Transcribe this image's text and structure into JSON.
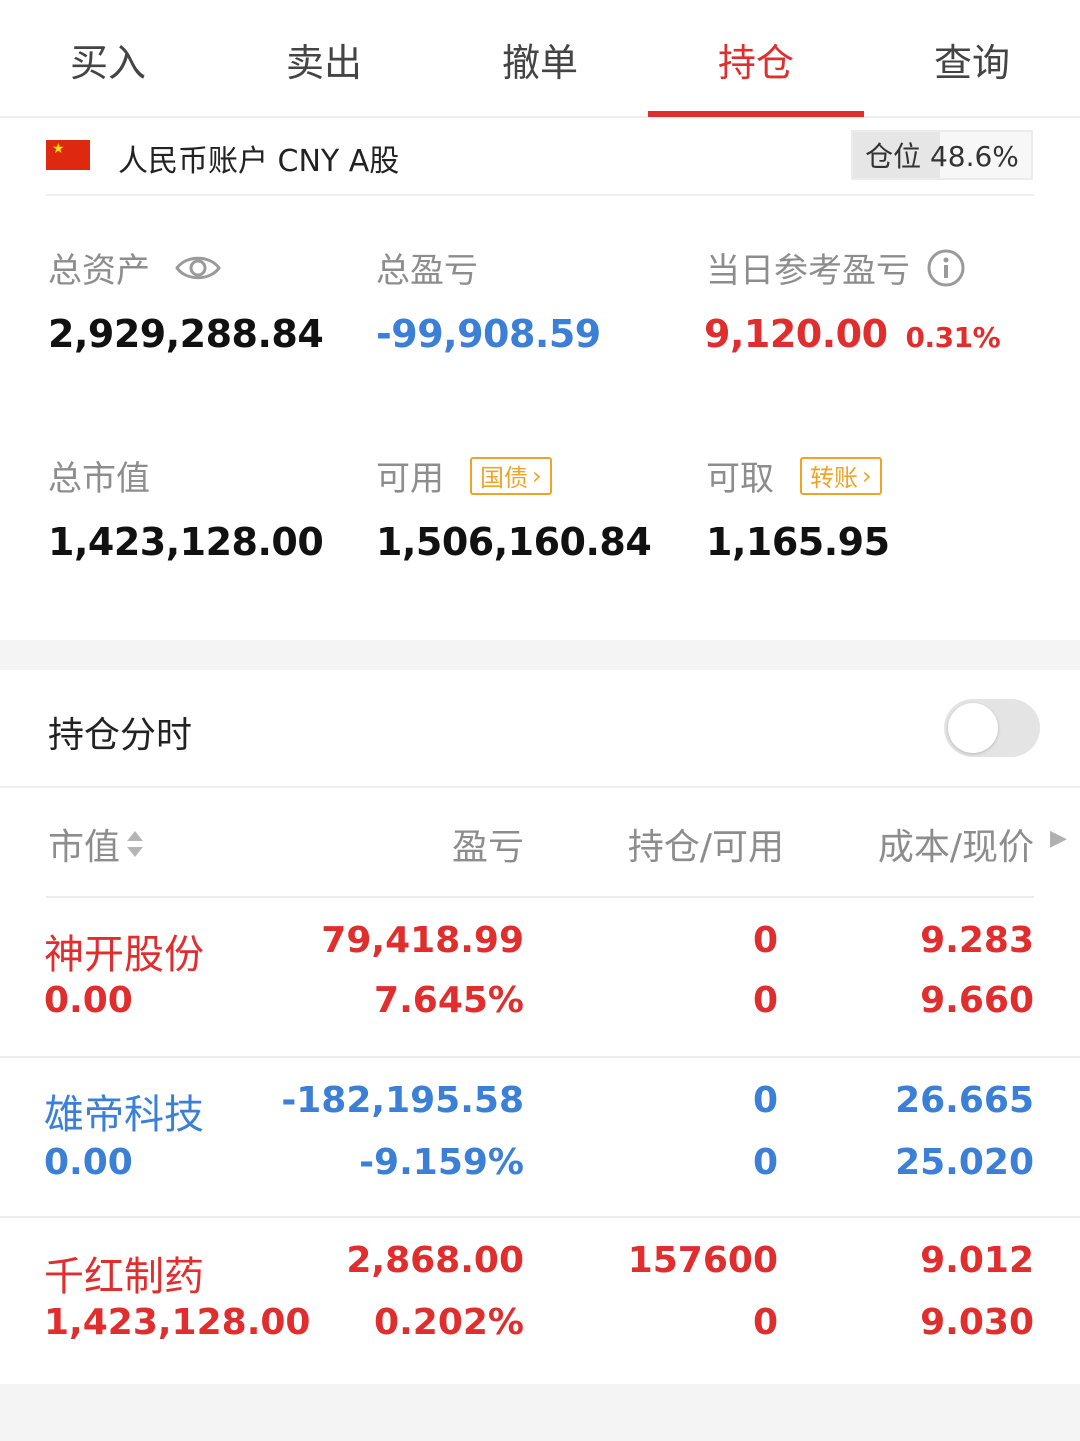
{
  "tabs": [
    {
      "label": "买入"
    },
    {
      "label": "卖出"
    },
    {
      "label": "撤单"
    },
    {
      "label": "持仓",
      "active": true
    },
    {
      "label": "查询"
    }
  ],
  "account": {
    "label": "人民币账户 CNY A股",
    "position_label": "仓位 48.6%",
    "position_fraction": 0.486,
    "flag_icon": "china-flag-icon"
  },
  "stats": {
    "total_assets": {
      "label": "总资产",
      "value": "2,929,288.84"
    },
    "total_pnl": {
      "label": "总盈亏",
      "value": "-99,908.59"
    },
    "daily_pnl": {
      "label": "当日参考盈亏",
      "value": "9,120.00",
      "pct": "0.31%"
    },
    "market_value": {
      "label": "总市值",
      "value": "1,423,128.00"
    },
    "available": {
      "label": "可用",
      "value": "1,506,160.84",
      "tag": "国债"
    },
    "withdrawable": {
      "label": "可取",
      "value": "1,165.95",
      "tag": "转账"
    }
  },
  "timeline": {
    "label": "持仓分时",
    "enabled": false
  },
  "table": {
    "headers": [
      "市值",
      "盈亏",
      "持仓/可用",
      "成本/现价"
    ],
    "rows": [
      {
        "name": "神开股份",
        "market_value": "0.00",
        "pnl": "79,418.99",
        "pnl_pct": "7.645%",
        "holding": "0",
        "available": "0",
        "cost": "9.283",
        "price": "9.660",
        "color": "#e02e2e"
      },
      {
        "name": "雄帝科技",
        "market_value": "0.00",
        "pnl": "-182,195.58",
        "pnl_pct": "-9.159%",
        "holding": "0",
        "available": "0",
        "cost": "26.665",
        "price": "25.020",
        "color": "#3b80d6"
      },
      {
        "name": "千红制药",
        "market_value": "1,423,128.00",
        "pnl": "2,868.00",
        "pnl_pct": "0.202%",
        "holding": "157600",
        "available": "0",
        "cost": "9.012",
        "price": "9.030",
        "color": "#e02e2e"
      }
    ]
  },
  "colors": {
    "up": "#e02e2e",
    "down": "#3b80d6",
    "tag": "#f0a426"
  }
}
